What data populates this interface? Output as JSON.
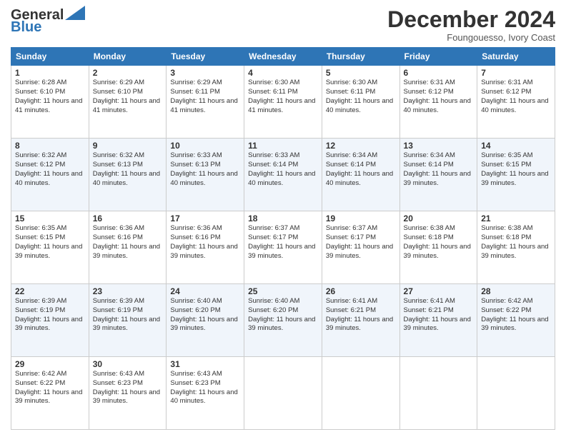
{
  "logo": {
    "line1": "General",
    "line2": "Blue"
  },
  "header": {
    "title": "December 2024",
    "location": "Foungouesso, Ivory Coast"
  },
  "days_of_week": [
    "Sunday",
    "Monday",
    "Tuesday",
    "Wednesday",
    "Thursday",
    "Friday",
    "Saturday"
  ],
  "weeks": [
    [
      {
        "day": "1",
        "sunrise": "6:28 AM",
        "sunset": "6:10 PM",
        "daylight": "11 hours and 41 minutes."
      },
      {
        "day": "2",
        "sunrise": "6:29 AM",
        "sunset": "6:10 PM",
        "daylight": "11 hours and 41 minutes."
      },
      {
        "day": "3",
        "sunrise": "6:29 AM",
        "sunset": "6:11 PM",
        "daylight": "11 hours and 41 minutes."
      },
      {
        "day": "4",
        "sunrise": "6:30 AM",
        "sunset": "6:11 PM",
        "daylight": "11 hours and 41 minutes."
      },
      {
        "day": "5",
        "sunrise": "6:30 AM",
        "sunset": "6:11 PM",
        "daylight": "11 hours and 40 minutes."
      },
      {
        "day": "6",
        "sunrise": "6:31 AM",
        "sunset": "6:12 PM",
        "daylight": "11 hours and 40 minutes."
      },
      {
        "day": "7",
        "sunrise": "6:31 AM",
        "sunset": "6:12 PM",
        "daylight": "11 hours and 40 minutes."
      }
    ],
    [
      {
        "day": "8",
        "sunrise": "6:32 AM",
        "sunset": "6:12 PM",
        "daylight": "11 hours and 40 minutes."
      },
      {
        "day": "9",
        "sunrise": "6:32 AM",
        "sunset": "6:13 PM",
        "daylight": "11 hours and 40 minutes."
      },
      {
        "day": "10",
        "sunrise": "6:33 AM",
        "sunset": "6:13 PM",
        "daylight": "11 hours and 40 minutes."
      },
      {
        "day": "11",
        "sunrise": "6:33 AM",
        "sunset": "6:14 PM",
        "daylight": "11 hours and 40 minutes."
      },
      {
        "day": "12",
        "sunrise": "6:34 AM",
        "sunset": "6:14 PM",
        "daylight": "11 hours and 40 minutes."
      },
      {
        "day": "13",
        "sunrise": "6:34 AM",
        "sunset": "6:14 PM",
        "daylight": "11 hours and 39 minutes."
      },
      {
        "day": "14",
        "sunrise": "6:35 AM",
        "sunset": "6:15 PM",
        "daylight": "11 hours and 39 minutes."
      }
    ],
    [
      {
        "day": "15",
        "sunrise": "6:35 AM",
        "sunset": "6:15 PM",
        "daylight": "11 hours and 39 minutes."
      },
      {
        "day": "16",
        "sunrise": "6:36 AM",
        "sunset": "6:16 PM",
        "daylight": "11 hours and 39 minutes."
      },
      {
        "day": "17",
        "sunrise": "6:36 AM",
        "sunset": "6:16 PM",
        "daylight": "11 hours and 39 minutes."
      },
      {
        "day": "18",
        "sunrise": "6:37 AM",
        "sunset": "6:17 PM",
        "daylight": "11 hours and 39 minutes."
      },
      {
        "day": "19",
        "sunrise": "6:37 AM",
        "sunset": "6:17 PM",
        "daylight": "11 hours and 39 minutes."
      },
      {
        "day": "20",
        "sunrise": "6:38 AM",
        "sunset": "6:18 PM",
        "daylight": "11 hours and 39 minutes."
      },
      {
        "day": "21",
        "sunrise": "6:38 AM",
        "sunset": "6:18 PM",
        "daylight": "11 hours and 39 minutes."
      }
    ],
    [
      {
        "day": "22",
        "sunrise": "6:39 AM",
        "sunset": "6:19 PM",
        "daylight": "11 hours and 39 minutes."
      },
      {
        "day": "23",
        "sunrise": "6:39 AM",
        "sunset": "6:19 PM",
        "daylight": "11 hours and 39 minutes."
      },
      {
        "day": "24",
        "sunrise": "6:40 AM",
        "sunset": "6:20 PM",
        "daylight": "11 hours and 39 minutes."
      },
      {
        "day": "25",
        "sunrise": "6:40 AM",
        "sunset": "6:20 PM",
        "daylight": "11 hours and 39 minutes."
      },
      {
        "day": "26",
        "sunrise": "6:41 AM",
        "sunset": "6:21 PM",
        "daylight": "11 hours and 39 minutes."
      },
      {
        "day": "27",
        "sunrise": "6:41 AM",
        "sunset": "6:21 PM",
        "daylight": "11 hours and 39 minutes."
      },
      {
        "day": "28",
        "sunrise": "6:42 AM",
        "sunset": "6:22 PM",
        "daylight": "11 hours and 39 minutes."
      }
    ],
    [
      {
        "day": "29",
        "sunrise": "6:42 AM",
        "sunset": "6:22 PM",
        "daylight": "11 hours and 39 minutes."
      },
      {
        "day": "30",
        "sunrise": "6:43 AM",
        "sunset": "6:23 PM",
        "daylight": "11 hours and 39 minutes."
      },
      {
        "day": "31",
        "sunrise": "6:43 AM",
        "sunset": "6:23 PM",
        "daylight": "11 hours and 40 minutes."
      },
      null,
      null,
      null,
      null
    ]
  ]
}
